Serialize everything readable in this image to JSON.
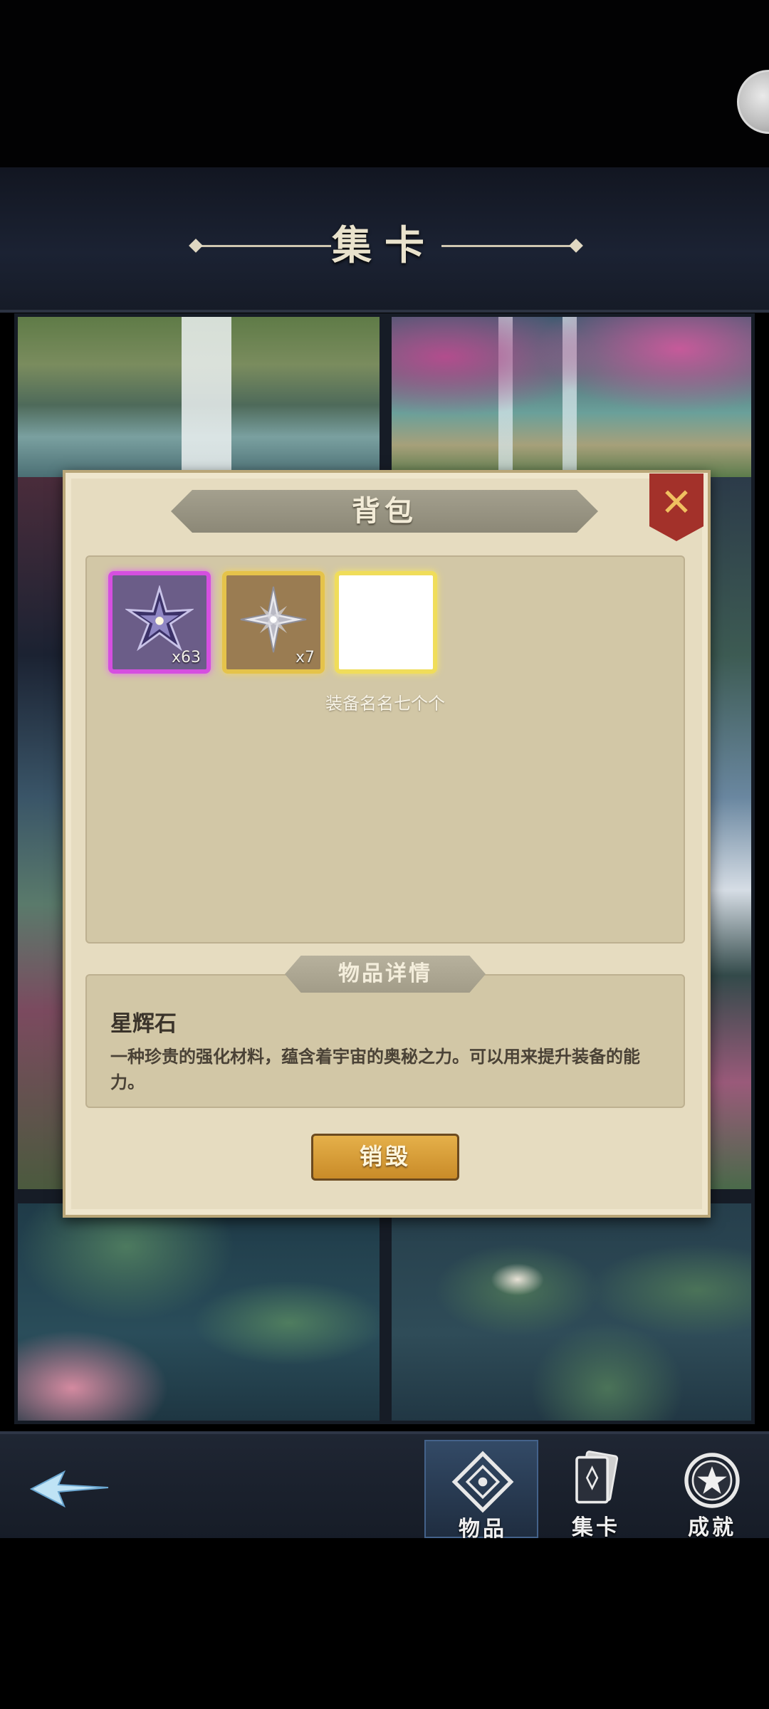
{
  "header": {
    "title": "集卡"
  },
  "backpack": {
    "title": "背包",
    "slots": [
      {
        "icon": "purple-star-icon",
        "count": "x63",
        "rarity_color": "#d54fe0"
      },
      {
        "icon": "silver-star-icon",
        "count": "x7",
        "rarity_color": "#e5c34a"
      },
      {
        "icon": "empty-slot",
        "count": "",
        "rarity_color": "#f0dd5a"
      }
    ],
    "hint": "装备名名七个个"
  },
  "details": {
    "header": "物品详情",
    "item_name": "星辉石",
    "description": "一种珍贵的强化材料，蕴含着宇宙的奥秘之力。可以用来提升装备的能力。",
    "destroy_label": "销毁"
  },
  "nav": {
    "tabs": [
      {
        "label": "物品",
        "icon": "items-icon",
        "active": true
      },
      {
        "label": "集卡",
        "icon": "cards-icon",
        "active": false
      },
      {
        "label": "成就",
        "icon": "achievement-star-icon",
        "active": false
      }
    ]
  },
  "colors": {
    "panel": "#e6dcc0",
    "close": "#a3312a",
    "button": "#d49a33",
    "nav_active": "#2a3d57"
  }
}
